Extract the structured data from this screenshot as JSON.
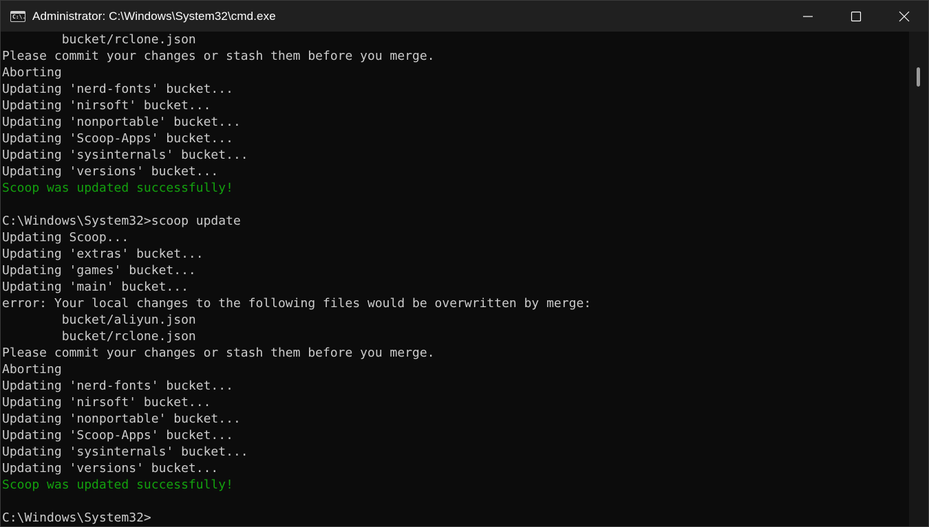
{
  "window": {
    "title": "Administrator: C:\\Windows\\System32\\cmd.exe",
    "app_icon_glyph": "C:\\.",
    "colors": {
      "background": "#0c0c0c",
      "titlebar": "#202020",
      "text": "#cccccc",
      "success": "#13a10e"
    }
  },
  "controls": {
    "minimize": "minimize-icon",
    "maximize": "maximize-icon",
    "close": "close-icon"
  },
  "console": {
    "lines": [
      {
        "text": "        bucket/rclone.json",
        "kind": "normal"
      },
      {
        "text": "Please commit your changes or stash them before you merge.",
        "kind": "normal"
      },
      {
        "text": "Aborting",
        "kind": "normal"
      },
      {
        "text": "Updating 'nerd-fonts' bucket...",
        "kind": "normal"
      },
      {
        "text": "Updating 'nirsoft' bucket...",
        "kind": "normal"
      },
      {
        "text": "Updating 'nonportable' bucket...",
        "kind": "normal"
      },
      {
        "text": "Updating 'Scoop-Apps' bucket...",
        "kind": "normal"
      },
      {
        "text": "Updating 'sysinternals' bucket...",
        "kind": "normal"
      },
      {
        "text": "Updating 'versions' bucket...",
        "kind": "normal"
      },
      {
        "text": "Scoop was updated successfully!",
        "kind": "success"
      },
      {
        "text": "",
        "kind": "normal"
      },
      {
        "text": "C:\\Windows\\System32>scoop update",
        "kind": "normal"
      },
      {
        "text": "Updating Scoop...",
        "kind": "normal"
      },
      {
        "text": "Updating 'extras' bucket...",
        "kind": "normal"
      },
      {
        "text": "Updating 'games' bucket...",
        "kind": "normal"
      },
      {
        "text": "Updating 'main' bucket...",
        "kind": "normal"
      },
      {
        "text": "error: Your local changes to the following files would be overwritten by merge:",
        "kind": "normal"
      },
      {
        "text": "        bucket/aliyun.json",
        "kind": "normal"
      },
      {
        "text": "        bucket/rclone.json",
        "kind": "normal"
      },
      {
        "text": "Please commit your changes or stash them before you merge.",
        "kind": "normal"
      },
      {
        "text": "Aborting",
        "kind": "normal"
      },
      {
        "text": "Updating 'nerd-fonts' bucket...",
        "kind": "normal"
      },
      {
        "text": "Updating 'nirsoft' bucket...",
        "kind": "normal"
      },
      {
        "text": "Updating 'nonportable' bucket...",
        "kind": "normal"
      },
      {
        "text": "Updating 'Scoop-Apps' bucket...",
        "kind": "normal"
      },
      {
        "text": "Updating 'sysinternals' bucket...",
        "kind": "normal"
      },
      {
        "text": "Updating 'versions' bucket...",
        "kind": "normal"
      },
      {
        "text": "Scoop was updated successfully!",
        "kind": "success"
      },
      {
        "text": "",
        "kind": "normal"
      },
      {
        "text": "C:\\Windows\\System32>",
        "kind": "normal"
      }
    ]
  }
}
